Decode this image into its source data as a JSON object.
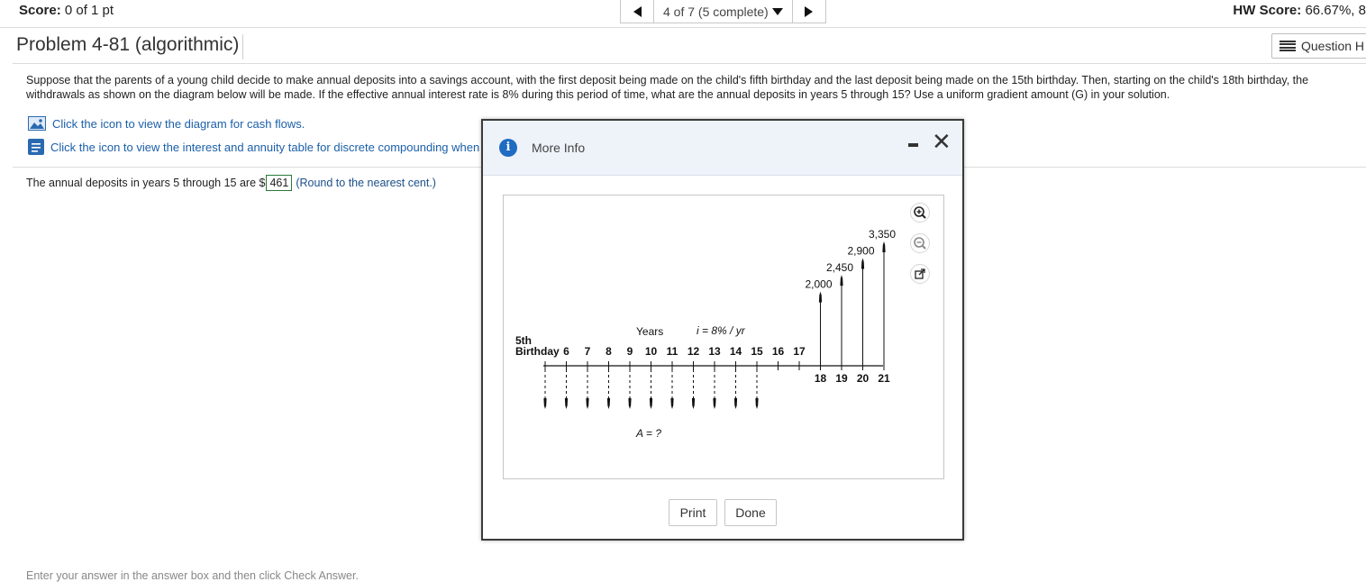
{
  "header": {
    "score_label": "Score:",
    "score_value": "0 of 1 pt",
    "position_text": "4 of 7 (5 complete)",
    "hw_label": "HW Score:",
    "hw_value": "66.67%, 8"
  },
  "problem": {
    "title": "Problem 4-81 (algorithmic)",
    "question_help": "Question H",
    "text": "Suppose that the parents of a young child decide to make annual deposits into a savings account, with the first deposit being made on the child's fifth birthday and the last deposit being made on the 15th birthday. Then, starting on the child's 18th birthday, the withdrawals as shown on the diagram below will be made. If the effective annual interest rate is 8% during this period of time, what are the annual deposits in years 5 through 15? Use a uniform gradient amount (G) in your solution.",
    "link_diagram": "Click the icon to view the diagram for cash flows.",
    "link_table": "Click the icon to view the interest and annuity table for discrete compounding when",
    "answer_prefix": "The annual deposits in years 5 through 15 are $",
    "answer_value": "461",
    "answer_hint": "(Round to the nearest cent.)",
    "bottom_cut": "Enter your answer in the answer box and then click Check Answer."
  },
  "modal": {
    "title": "More Info",
    "print_label": "Print",
    "done_label": "Done",
    "icons": [
      "info-icon",
      "minimize-icon",
      "close-icon",
      "zoom-in-icon",
      "zoom-out-icon",
      "popout-icon"
    ]
  },
  "diagram": {
    "years_label": "Years",
    "rate_label": "i = 8% / yr",
    "start_label_1": "5th",
    "start_label_2": "Birthday",
    "deposit_label": "A = ?",
    "upper_years": [
      "6",
      "7",
      "8",
      "9",
      "10",
      "11",
      "12",
      "13",
      "14",
      "15",
      "16",
      "17"
    ],
    "lower_years": [
      "18",
      "19",
      "20",
      "21"
    ],
    "withdrawals": [
      "2,000",
      "2,450",
      "2,900",
      "3,350"
    ],
    "withdrawal_values": [
      2000,
      2450,
      2900,
      3350
    ]
  }
}
